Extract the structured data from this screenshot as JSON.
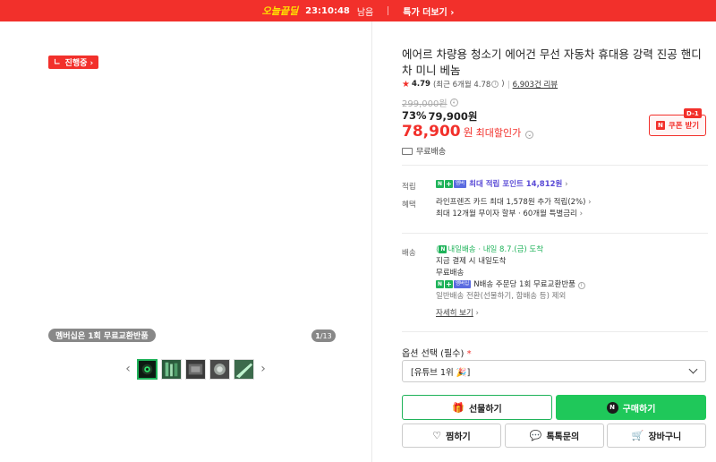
{
  "banner": {
    "brand": "오늘끝딜",
    "time": "23:10:48",
    "time_suffix": "남음",
    "more": "특가 더보기 ›"
  },
  "gallery": {
    "status_badge": "진행중 ›",
    "member_badge": "멤버십은 1회 무료교환반품",
    "counter_current": "1",
    "counter_total": "/13",
    "prev_icon": "chevron-left-icon",
    "next_icon": "chevron-right-icon",
    "thumb_count": 5
  },
  "product": {
    "title": "에어르 차량용 청소기 에어건 무선 자동차 휴대용 강력 진공 핸디 차 미니 베놈",
    "rating_score": "4.79",
    "rating_recent": "(최근 6개월 4.78",
    "rating_recent_close": ")",
    "reviews": "6,903건 리뷰",
    "original_price": "299,000원",
    "discount_rate": "73%",
    "sale_price": "79,900원",
    "final_price": "78,900",
    "final_unit": "원",
    "final_label": "최대할인가",
    "coupon_label": "쿠폰 받기",
    "coupon_dday": "D-1",
    "shipping_free": "무료배송"
  },
  "points": {
    "label": "적립",
    "text": "최대 적립 포인트 14,812원"
  },
  "benefits": {
    "label": "혜택",
    "line1": "라인프렌즈 카드 최대 1,578원 추가 적립(2%)",
    "line2": "최대 12개월 무이자 할부 · 60개월 특별금리"
  },
  "delivery": {
    "label": "배송",
    "arrival_badge": "내일배송",
    "arrival_text": "· 내일 8.7.(금) 도착",
    "line2": "지금 결제 시 내일도착",
    "line3": "무료배송",
    "line4": "N배송 주문당 1회 무료교환반품",
    "line5": "일반배송 전환(선물하기, 함배송 등) 제외",
    "detail_link": "자세히 보기"
  },
  "options": {
    "label": "옵션 선택 (필수)",
    "required_mark": "*",
    "selected": "[유튜브 1위 🎉]"
  },
  "actions": {
    "gift": "선물하기",
    "buy": "구매하기",
    "wish": "찜하기",
    "talk": "톡톡문의",
    "cart": "장바구니"
  },
  "colors": {
    "accent_red": "#f2302b",
    "naver_green": "#1fc85a",
    "point_purple": "#5a4bd6"
  }
}
